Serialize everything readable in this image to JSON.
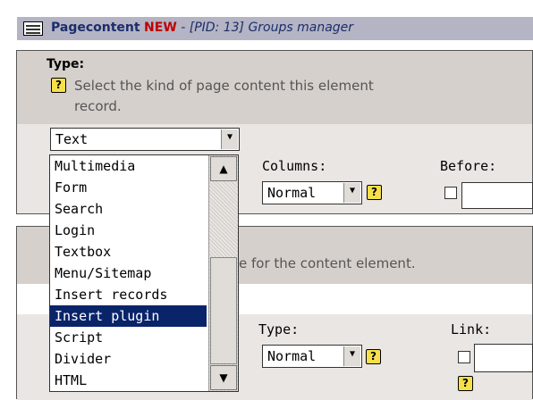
{
  "header": {
    "title_main": "Pagecontent",
    "title_new": "NEW",
    "title_rest": " - [PID: 13] Groups manager"
  },
  "section1": {
    "type_label": "Type:",
    "type_description_line1": "Select the kind of page content this element",
    "type_description_line2": "record.",
    "type_select_value": "Text",
    "columns_label": "Columns:",
    "columns_value": "Normal",
    "before_label": "Before:"
  },
  "dropdown": {
    "items": [
      "Multimedia",
      "Form",
      "Search",
      "Login",
      "Textbox",
      "Menu/Sitemap",
      "Insert records",
      "Insert plugin",
      "Script",
      "Divider",
      "HTML"
    ],
    "selected": "Insert plugin"
  },
  "section2": {
    "description": "e for the content element.",
    "type_label": "Type:",
    "type_value": "Normal",
    "link_label": "Link:"
  },
  "icons": {
    "help": "help-icon",
    "arrow_down": "▼",
    "arrow_up": "▲"
  }
}
